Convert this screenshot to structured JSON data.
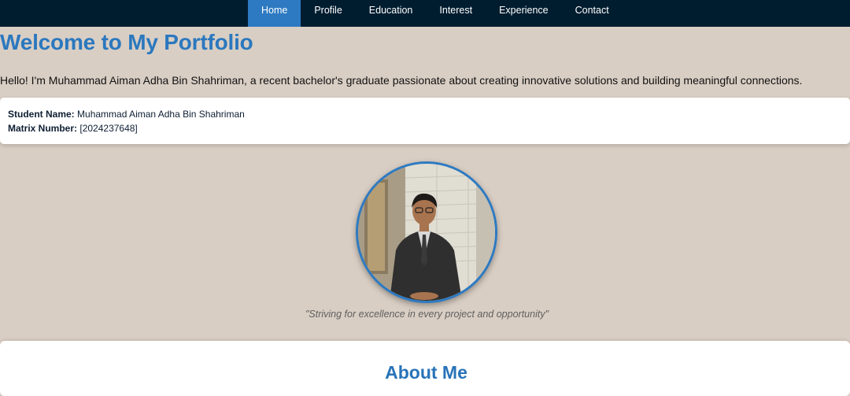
{
  "nav": {
    "items": [
      {
        "label": "Home",
        "active": true
      },
      {
        "label": "Profile",
        "active": false
      },
      {
        "label": "Education",
        "active": false
      },
      {
        "label": "Interest",
        "active": false
      },
      {
        "label": "Experience",
        "active": false
      },
      {
        "label": "Contact",
        "active": false
      }
    ]
  },
  "header": {
    "title": "Welcome to My Portfolio",
    "intro": "Hello! I'm Muhammad Aiman Adha Bin Shahriman, a recent bachelor's graduate passionate about creating innovative solutions and building meaningful connections."
  },
  "student_info": {
    "name_label": "Student Name:",
    "name_value": "Muhammad Aiman Adha Bin Shahriman",
    "matrix_label": "Matrix Number:",
    "matrix_value": "[2024237648]"
  },
  "profile": {
    "quote": "\"Striving for excellence in every project and opportunity\""
  },
  "about": {
    "heading": "About Me"
  },
  "colors": {
    "navbar_bg": "#001d30",
    "nav_active": "#2d7ac2",
    "accent": "#2b78be",
    "page_bg": "#d9cec4"
  }
}
